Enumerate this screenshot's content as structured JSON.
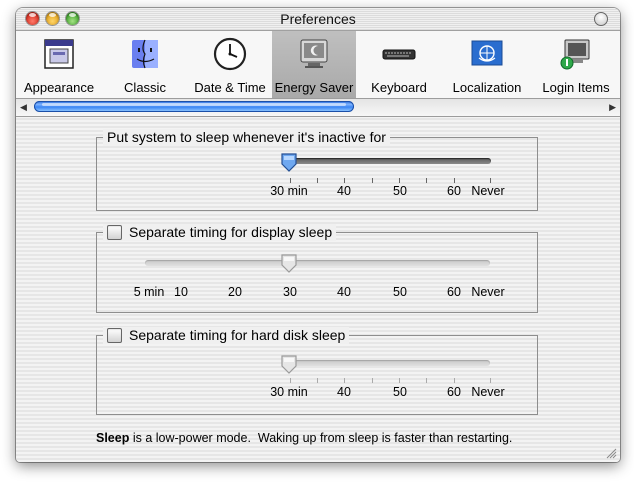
{
  "window": {
    "title": "Preferences"
  },
  "toolbar": {
    "items": [
      {
        "label": "Appearance",
        "icon": "appearance-icon"
      },
      {
        "label": "Classic",
        "icon": "classic-finder-icon"
      },
      {
        "label": "Date & Time",
        "icon": "clock-icon"
      },
      {
        "label": "Energy Saver",
        "icon": "energy-saver-icon"
      },
      {
        "label": "Keyboard",
        "icon": "keyboard-icon"
      },
      {
        "label": "Localization",
        "icon": "globe-flag-icon"
      },
      {
        "label": "Login Items",
        "icon": "login-items-icon"
      }
    ],
    "selected": "Energy Saver"
  },
  "system_sleep": {
    "label": "Put system to sleep whenever it's inactive for",
    "ticks": [
      "30 min",
      "40",
      "50",
      "60",
      "Never"
    ],
    "value": "30 min",
    "enabled": true
  },
  "display_sleep": {
    "label": "Separate timing for display sleep",
    "checked": false,
    "ticks": [
      "5 min",
      "10",
      "20",
      "30",
      "40",
      "50",
      "60",
      "Never"
    ],
    "value": "30",
    "enabled": false
  },
  "disk_sleep": {
    "label": "Separate timing for hard disk sleep",
    "checked": false,
    "ticks": [
      "30 min",
      "40",
      "50",
      "60",
      "Never"
    ],
    "value": "30 min",
    "enabled": false
  },
  "footer": {
    "bold": "Sleep",
    "text": " is a low-power mode.  Waking up from sleep is faster than restarting."
  },
  "colors": {
    "selection": "#a9a9a9",
    "scroll_thumb": "#3b86f4"
  }
}
